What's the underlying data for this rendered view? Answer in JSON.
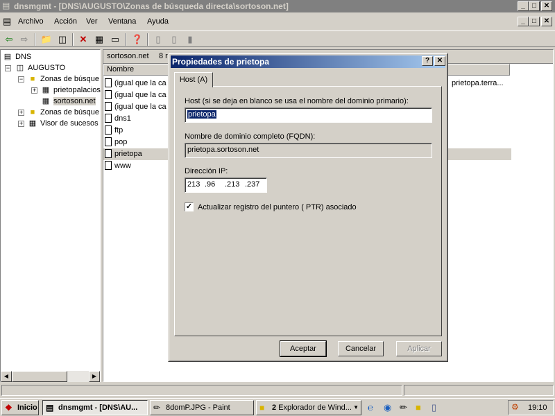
{
  "window": {
    "title": "dnsmgmt - [DNS\\AUGUSTO\\Zonas de búsqueda directa\\sortoson.net]",
    "minimize": "_",
    "maximize": "□",
    "close": "✕"
  },
  "menu": {
    "archivo": "Archivo",
    "accion": "Acción",
    "ver": "Ver",
    "ventana": "Ventana",
    "ayuda": "Ayuda"
  },
  "tree": {
    "dns": "DNS",
    "augusto": "AUGUSTO",
    "zonas_directa": "Zonas de búsque",
    "prietopalacios": "prietopalacios",
    "sortoson": "sortoson.net",
    "zonas_inversa": "Zonas de búsque",
    "visor": "Visor de sucesos"
  },
  "right": {
    "header_title": "sortoson.net",
    "header_count": "8 r",
    "col_nombre": "Nombre",
    "rows": [
      "(igual que la ca",
      "(igual que la ca",
      "(igual que la ca",
      "dns1",
      "ftp",
      "pop",
      "prietopa",
      "www"
    ],
    "data_partial": "prietopa.terra..."
  },
  "dialog": {
    "title": "Propiedades de prietopa",
    "help": "?",
    "close": "✕",
    "tab": "Host (A)",
    "host_label": "Host (si se deja en blanco se usa el nombre del dominio primario):",
    "host_value": "prietopa",
    "fqdn_label": "Nombre de dominio completo (FQDN):",
    "fqdn_value": "prietopa.sortoson.net",
    "ip_label": "Dirección IP:",
    "ip": [
      "213",
      ".96",
      ".213",
      ".237"
    ],
    "ptr_label": "Actualizar registro del puntero ( PTR) asociado",
    "ptr_checked": true,
    "btn_ok": "Aceptar",
    "btn_cancel": "Cancelar",
    "btn_apply": "Aplicar"
  },
  "taskbar": {
    "start": "Inicio",
    "task1": "dnsmgmt - [DNS\\AU...",
    "task2": "8domP.JPG - Paint",
    "task3_count": "2",
    "task3": "Explorador de Wind...",
    "clock": "19:10"
  },
  "colors": {
    "title_active_start": "#0a246a",
    "title_active_end": "#a6caf0",
    "title_inactive": "#808080",
    "face": "#d4d0c8"
  }
}
